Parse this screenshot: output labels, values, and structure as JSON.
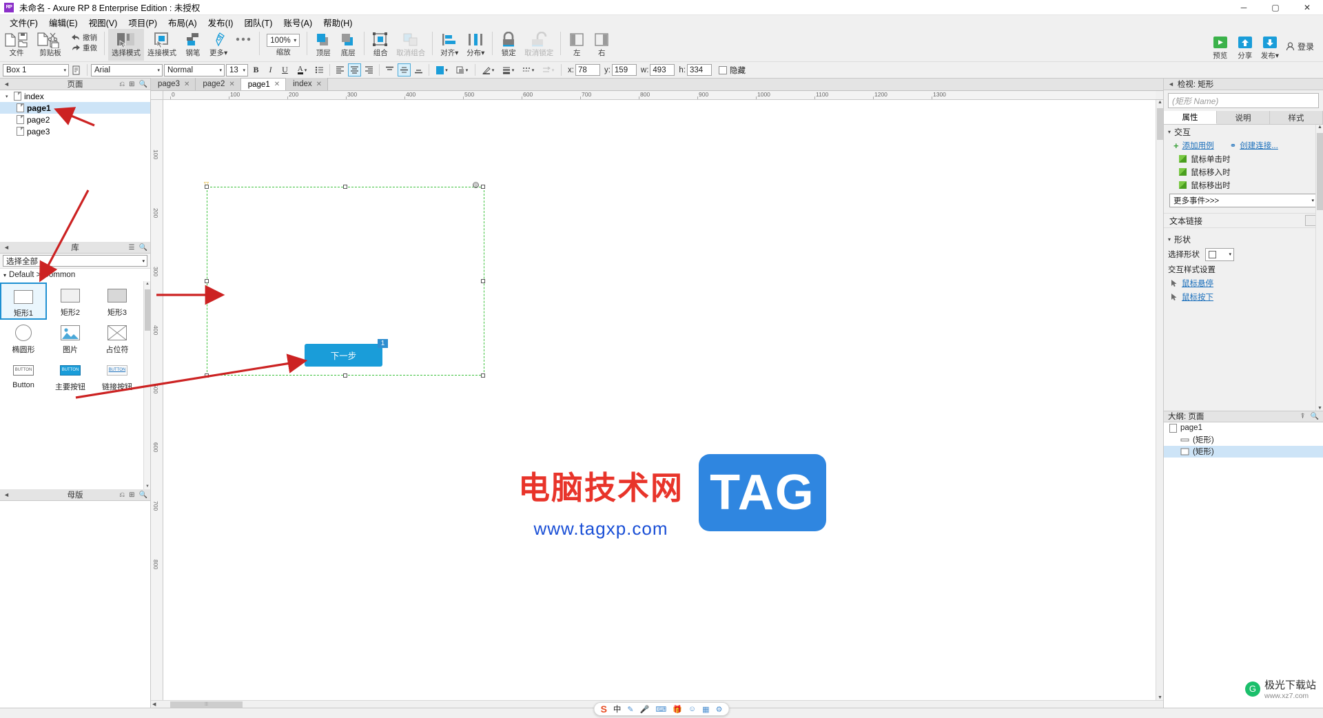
{
  "window": {
    "title": "未命名 - Axure RP 8 Enterprise Edition : 未授权",
    "logo": "RP",
    "minimize": "─",
    "maximize": "▢",
    "close": "✕"
  },
  "menubar": {
    "items": [
      {
        "label": "文件(F)",
        "name": "menu-file"
      },
      {
        "label": "编辑(E)",
        "name": "menu-edit"
      },
      {
        "label": "视图(V)",
        "name": "menu-view"
      },
      {
        "label": "项目(P)",
        "name": "menu-project"
      },
      {
        "label": "布局(A)",
        "name": "menu-layout"
      },
      {
        "label": "发布(I)",
        "name": "menu-publish"
      },
      {
        "label": "团队(T)",
        "name": "menu-team"
      },
      {
        "label": "账号(A)",
        "name": "menu-account"
      },
      {
        "label": "帮助(H)",
        "name": "menu-help"
      }
    ]
  },
  "toolbar": {
    "file_label": "文件",
    "clipboard_label": "剪贴板",
    "undo_label": "撤销",
    "redo_label": "重做",
    "select_mode_label": "选择模式",
    "connect_mode_label": "连接模式",
    "pen_label": "钢笔",
    "more_label": "更多",
    "zoom_label": "缩放",
    "zoom_value": "100%",
    "top_label": "顶层",
    "bottom_label": "底层",
    "group_label": "组合",
    "ungroup_label": "取消组合",
    "align_label": "对齐",
    "distribute_label": "分布",
    "lock_label": "锁定",
    "unlock_label": "取消锁定",
    "left_label": "左",
    "right_label": "右",
    "preview_label": "预览",
    "share_label": "分享",
    "publish_label": "发布",
    "login_label": "登录",
    "caret": "▾"
  },
  "propbar": {
    "widget_name": "Box 1",
    "font_family": "Arial",
    "font_style": "Normal",
    "font_size": "13",
    "bold": "B",
    "italic": "I",
    "underline": "U",
    "text_color": "A",
    "list": "☰",
    "align_left": "≡",
    "align_center": "≡",
    "align_right": "≡",
    "valign_top": "⎺",
    "valign_middle": "⎼",
    "valign_bottom": "⎽",
    "fill_color": "■",
    "shadow": "◧",
    "line_color": "✎",
    "line_width": "▤",
    "line_type": "┉",
    "line_arrow": "⇥",
    "x_label": "x:",
    "x_value": "78",
    "y_label": "y:",
    "y_value": "159",
    "w_label": "w:",
    "w_value": "493",
    "h_label": "h:",
    "h_value": "334",
    "hidden_label": "隐藏",
    "caret": "▾"
  },
  "pages_panel": {
    "title": "页面",
    "tree": [
      {
        "label": "index",
        "depth": 0,
        "arrow": "▾",
        "selected": false,
        "bold": false
      },
      {
        "label": "page1",
        "depth": 1,
        "arrow": "",
        "selected": true,
        "bold": true
      },
      {
        "label": "page2",
        "depth": 1,
        "arrow": "",
        "selected": false,
        "bold": false
      },
      {
        "label": "page3",
        "depth": 1,
        "arrow": "",
        "selected": false,
        "bold": false
      }
    ]
  },
  "library_panel": {
    "title": "库",
    "selector_value": "选择全部",
    "group_label": "Default > Common",
    "group_arrow": "▾",
    "items": [
      {
        "label": "矩形1",
        "icon": "rectangle-1",
        "selected": true
      },
      {
        "label": "矩形2",
        "icon": "rectangle-2",
        "selected": false
      },
      {
        "label": "矩形3",
        "icon": "rectangle-3",
        "selected": false
      },
      {
        "label": "椭圆形",
        "icon": "ellipse",
        "selected": false
      },
      {
        "label": "图片",
        "icon": "image",
        "selected": false
      },
      {
        "label": "占位符",
        "icon": "placeholder",
        "selected": false
      },
      {
        "label": "Button",
        "icon": "button",
        "selected": false
      },
      {
        "label": "主要按钮",
        "icon": "primary-button",
        "selected": false
      },
      {
        "label": "链接按钮",
        "icon": "link-button",
        "selected": false
      }
    ]
  },
  "masters_panel": {
    "title": "母版"
  },
  "tabs": [
    {
      "label": "page3",
      "active": false
    },
    {
      "label": "page2",
      "active": false
    },
    {
      "label": "page1",
      "active": true
    },
    {
      "label": "index",
      "active": false
    }
  ],
  "canvas": {
    "h_ticks": [
      "0",
      "100",
      "200",
      "300",
      "400",
      "500",
      "600",
      "700",
      "800",
      "900",
      "1000",
      "1100",
      "1200",
      "1300"
    ],
    "v_ticks": [
      "100",
      "200",
      "300",
      "400",
      "500",
      "600",
      "700",
      "800"
    ],
    "button_widget": {
      "label": "下一步",
      "badge": "1"
    },
    "rotation_marker": "▽",
    "corner_marker": "◎"
  },
  "watermark": {
    "chinese": "电脑技术网",
    "url": "www.tagxp.com",
    "tag": "TAG"
  },
  "inspector": {
    "title": "检视: 矩形",
    "name_placeholder": "(矩形 Name)",
    "tabs": [
      {
        "label": "属性",
        "active": true
      },
      {
        "label": "说明",
        "active": false
      },
      {
        "label": "样式",
        "active": false
      }
    ],
    "interaction": {
      "section_label": "交互",
      "arrow": "▾",
      "add_case_label": "添加用例",
      "create_link_label": "创建连接...",
      "link_icon": "⚭",
      "plus_icon": "+",
      "events": [
        "鼠标单击时",
        "鼠标移入时",
        "鼠标移出时"
      ],
      "more_events_label": "更多事件>>>"
    },
    "text_link": {
      "label": "文本链接"
    },
    "shape": {
      "section_label": "形状",
      "arrow": "▾",
      "select_shape_label": "选择形状",
      "interaction_style_label": "交互样式设置",
      "mouse_hover_label": "鼠标悬停",
      "mouse_down_label": "鼠标按下"
    }
  },
  "outline_panel": {
    "title": "大纲: 页面",
    "items": [
      {
        "label": "page1",
        "depth": 0,
        "icon": "page-icon",
        "selected": false
      },
      {
        "label": "(矩形)",
        "depth": 1,
        "icon": "line-icon",
        "selected": false
      },
      {
        "label": "(矩形)",
        "depth": 1,
        "icon": "rect-icon",
        "selected": true
      }
    ]
  },
  "ime": {
    "logo": "S",
    "mode": "中",
    "items": [
      "✎",
      "🎤",
      "⌨",
      "🎁",
      "☺",
      "▦",
      "⚙"
    ]
  },
  "brand": {
    "circle": "G",
    "line1": "极光下载站",
    "line2": "www.xz7.com"
  },
  "colors": {
    "accent": "#1a9dd9",
    "selection": "#cde4f7",
    "green_dash": "#3ac13a",
    "annotation_red": "#cc2222",
    "link_blue": "#1b6fbb"
  }
}
